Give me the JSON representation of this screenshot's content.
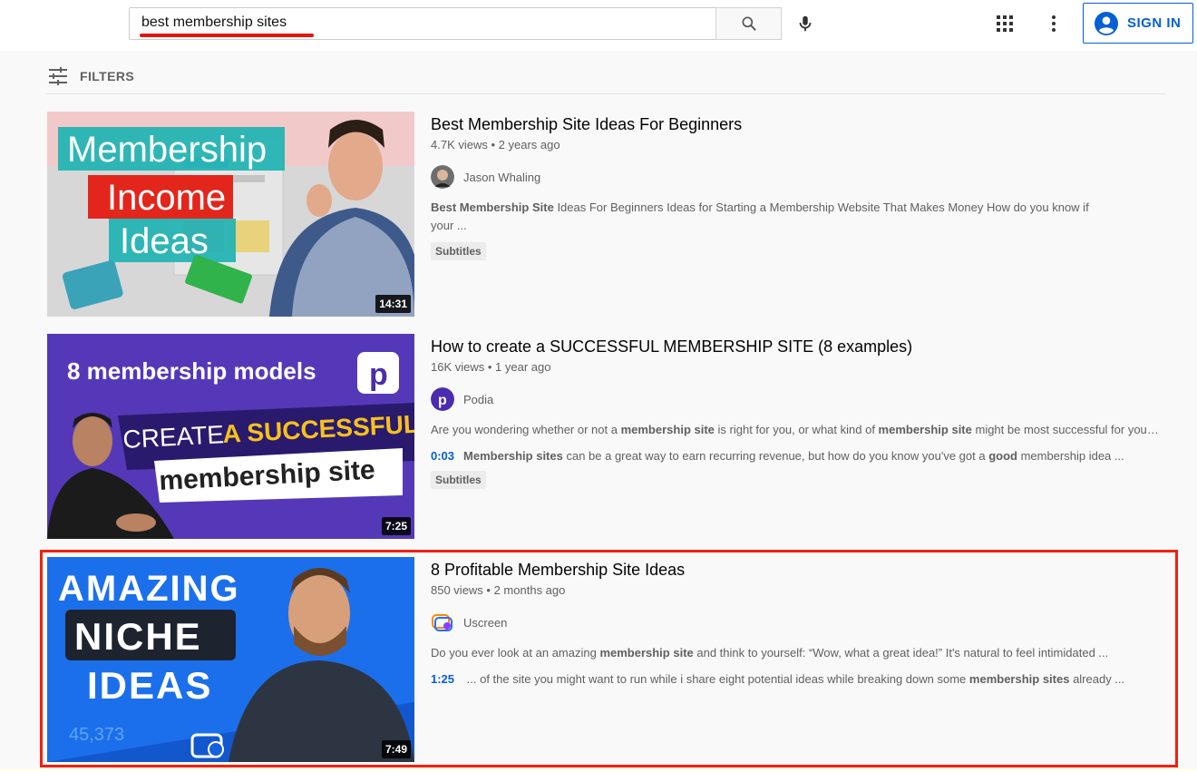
{
  "search": {
    "query": "best membership sites"
  },
  "header": {
    "sign_in_label": "SIGN IN"
  },
  "filters": {
    "label": "FILTERS"
  },
  "results": [
    {
      "title": "Best Membership Site Ideas For Beginners",
      "views": "4.7K views",
      "age": "2 years ago",
      "channel": "Jason Whaling",
      "duration": "14:31",
      "thumb_lines": [
        "Membership",
        "Income",
        "Ideas"
      ],
      "desc1_pre": "",
      "desc1_bold": "Best Membership Site",
      "desc1_post": " Ideas For Beginners Ideas for Starting a Membership Website That Makes Money How do you know if",
      "desc1_line2": "your ...",
      "badge": "Subtitles"
    },
    {
      "title": "How to create a SUCCESSFUL MEMBERSHIP SITE (8 examples)",
      "views": "16K views",
      "age": "1 year ago",
      "channel": "Podia",
      "duration": "7:25",
      "thumb_top": "8 membership models",
      "thumb_create": "CREATE",
      "thumb_success": "A SUCCESSFUL",
      "thumb_site": "membership site",
      "desc_a1": "Are you wondering whether or not a ",
      "desc_b1": "membership site",
      "desc_a2": " is right for you, or what kind of ",
      "desc_b2": "membership site",
      "desc_a3": " might be most successful for your ...",
      "timestamp": "0:03",
      "ts_b1": "Membership sites",
      "ts_a1": " can be a great way to earn recurring revenue, but how do you know you've got a ",
      "ts_b2": "good",
      "ts_a2": " membership idea ...",
      "badge": "Subtitles"
    },
    {
      "title": "8 Profitable Membership Site Ideas",
      "views": "850 views",
      "age": "2 months ago",
      "channel": "Uscreen",
      "duration": "7:49",
      "thumb_lines": [
        "AMAZING",
        "NICHE",
        "IDEAS"
      ],
      "thumb_number": "45,373",
      "desc_a1": "Do you ever look at an amazing ",
      "desc_b1": "membership site",
      "desc_a2": " and think to yourself: “Wow, what a great idea!” It's natural to feel intimidated ...",
      "timestamp": "1:25",
      "ts_a1": " ... of the site you might want to run while i share eight potential ideas while breaking down some ",
      "ts_b1": "membership sites",
      "ts_a2": " already ..."
    }
  ],
  "colors": {
    "accent": "#065fd4",
    "highlight": "#f2200d",
    "underline": "#e3150d"
  }
}
